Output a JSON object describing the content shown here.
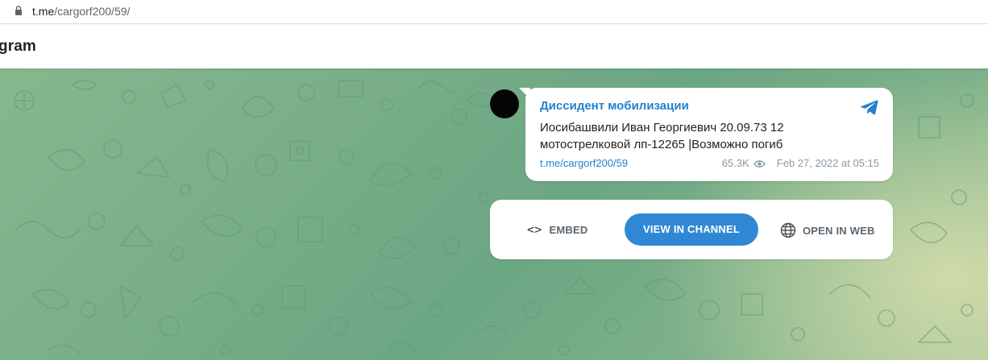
{
  "browser": {
    "url_host": "t.me",
    "url_path": "/cargorf200/59/"
  },
  "header": {
    "brand_visible_text": "gram"
  },
  "message": {
    "channel_name": "Диссидент мобилизации",
    "text": "Иосибашвили Иван Георгиевич 20.09.73 12 мотострелковой лп-12265 |Возможно погиб",
    "link": "t.me/cargorf200/59",
    "views": "65.3K",
    "date": "Feb 27, 2022 at 05:15",
    "accent_color": "#2481cc"
  },
  "actions": {
    "embed_label": "EMBED",
    "view_in_channel_label": "VIEW IN CHANNEL",
    "open_in_web_label": "OPEN IN WEB",
    "button_color": "#3088d4"
  },
  "icons": {
    "lock": "lock-icon",
    "telegram": "telegram-plane-icon",
    "eye": "eye-icon",
    "code": "code-icon",
    "globe": "globe-icon"
  }
}
